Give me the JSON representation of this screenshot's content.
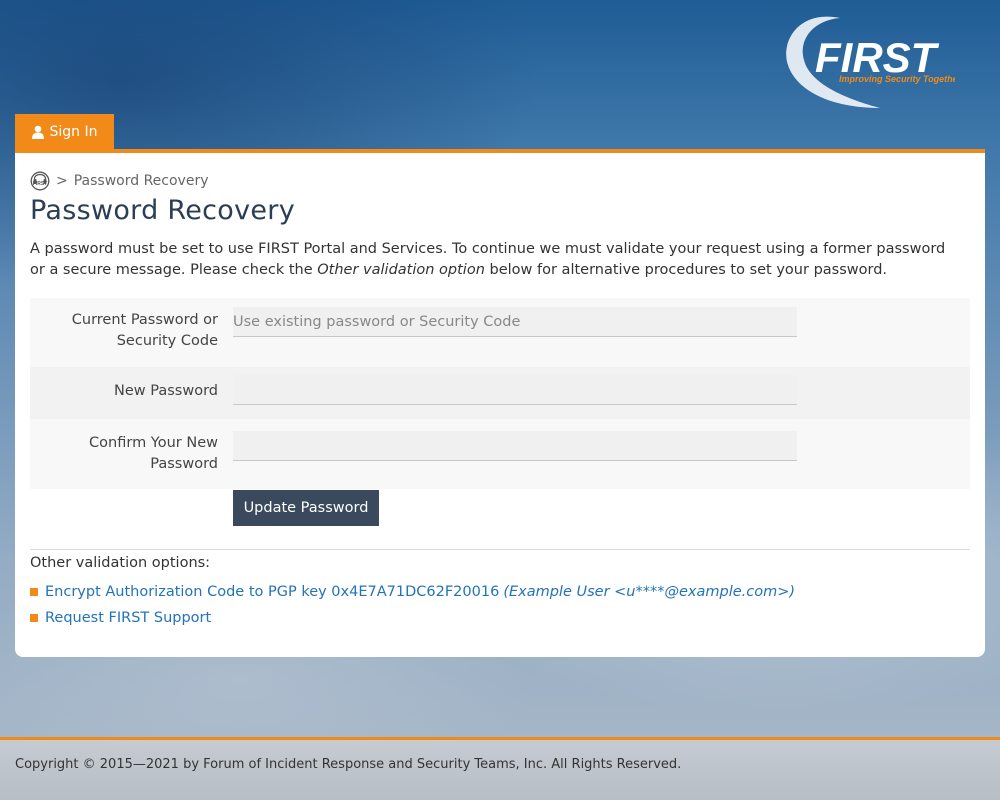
{
  "brand": {
    "logo_text": "FIRST",
    "tagline": "Improving Security Together",
    "accent_color": "#f28a1a"
  },
  "nav": {
    "signin_label": "Sign In"
  },
  "breadcrumb": {
    "separator": ">",
    "current": "Password Recovery"
  },
  "page": {
    "title": "Password Recovery",
    "intro_part1": "A password must be set to use FIRST Portal and Services. To continue we must validate your request using a former password or a secure message. Please check the ",
    "intro_emphasis": "Other validation option",
    "intro_part2": " below for alternative procedures to set your password."
  },
  "form": {
    "current_label": "Current Password or Security Code",
    "current_placeholder": "Use existing password or Security Code",
    "current_value": "",
    "new_label": "New Password",
    "new_value": "",
    "confirm_label": "Confirm Your New Password",
    "confirm_value": "",
    "submit_label": "Update Password"
  },
  "other": {
    "title": "Other validation options:",
    "options": [
      {
        "link": "Encrypt Authorization Code to PGP key 0x4E7A71DC62F20016",
        "example": "(Example User <u****@example.com>)"
      },
      {
        "link": "Request FIRST Support",
        "example": ""
      }
    ]
  },
  "footer": {
    "copyright": "Copyright © 2015—2021 by Forum of Incident Response and Security Teams, Inc. All Rights Reserved."
  }
}
